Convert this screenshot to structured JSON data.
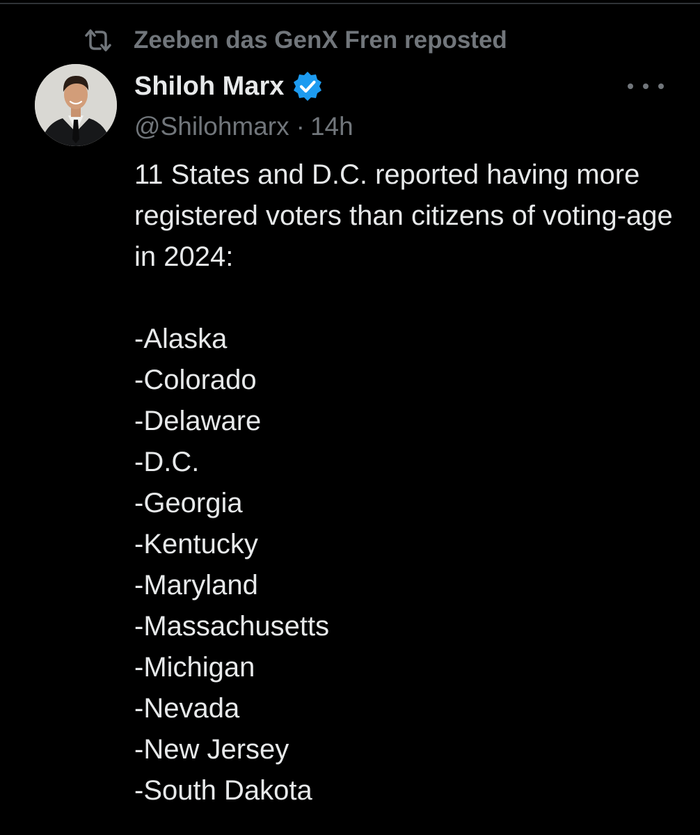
{
  "repost": {
    "icon": "repost-icon",
    "label": "Zeeben das GenX Fren reposted"
  },
  "author": {
    "avatar_icon": "avatar-photo",
    "display_name": "Shiloh Marx",
    "verified_icon": "verified-badge-icon",
    "verified_color": "#1d9bf0",
    "handle": "@Shilohmarx",
    "separator": "·",
    "timestamp": "14h"
  },
  "more_icon": "more-options-icon",
  "tweet": {
    "text": "11 States and D.C. reported having more registered voters than citizens of voting-age in 2024:",
    "list": [
      "-Alaska",
      "-Colorado",
      "-Delaware",
      "-D.C.",
      "-Georgia",
      "-Kentucky",
      "-Maryland",
      "-Massachusetts",
      "-Michigan",
      "-Nevada",
      "-New Jersey",
      "-South Dakota"
    ]
  },
  "colors": {
    "background": "#000000",
    "primary_text": "#e7e9ea",
    "secondary_text": "#71767b",
    "divider": "#2f3336"
  }
}
